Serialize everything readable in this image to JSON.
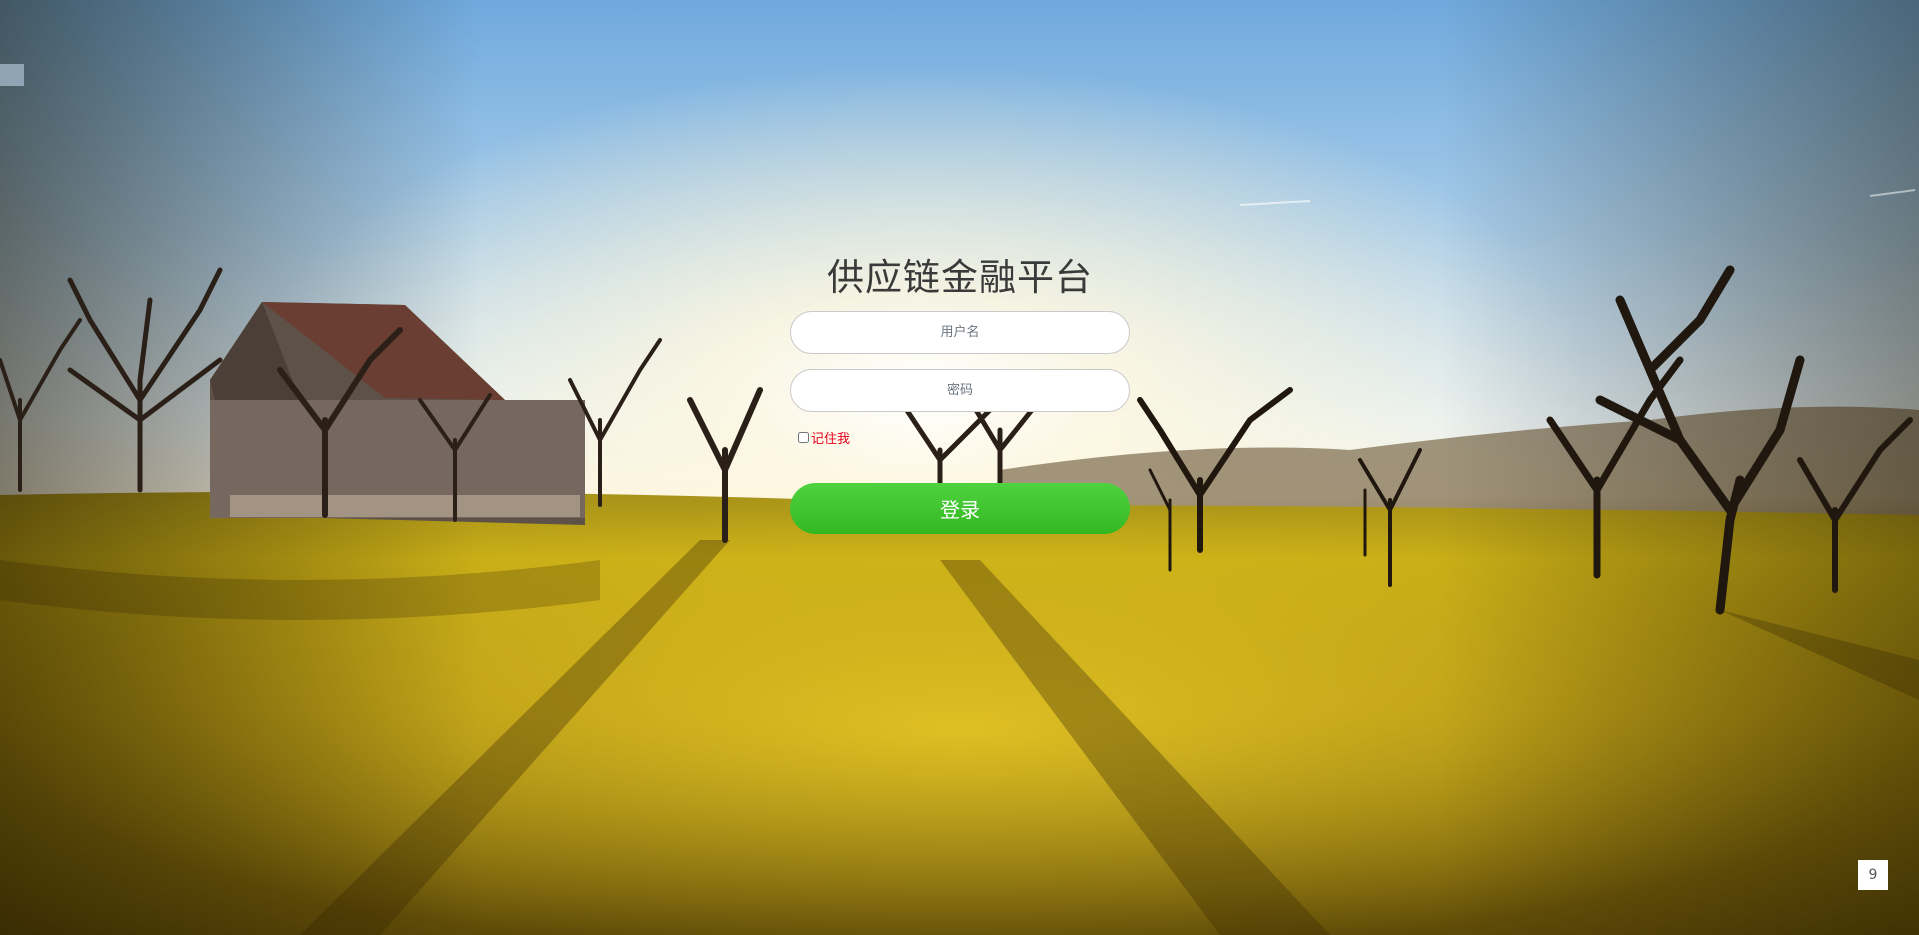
{
  "login": {
    "title": "供应链金融平台",
    "username_placeholder": "用户名",
    "password_placeholder": "密码",
    "remember_label": "记住我",
    "remember_checked": false,
    "submit_label": "登录"
  },
  "page_indicator": "9",
  "colors": {
    "button_green": "#3cc42b",
    "remember_red": "#e6001c",
    "title": "#3a3a3a"
  }
}
